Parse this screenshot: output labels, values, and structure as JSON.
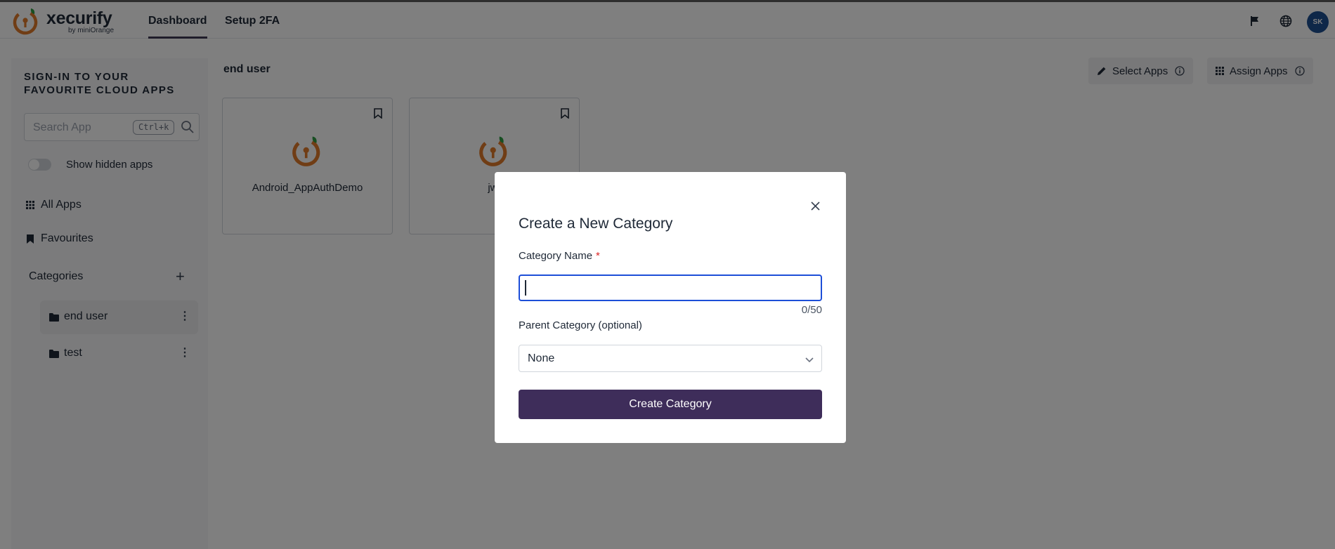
{
  "app": {
    "brand_name": "xecurify",
    "brand_by": "by miniOrange"
  },
  "header": {
    "tabs": [
      {
        "label": "Dashboard",
        "active": true
      },
      {
        "label": "Setup 2FA",
        "active": false
      }
    ],
    "icons": [
      "flag-icon",
      "globe-icon"
    ],
    "avatar_initials": "SK",
    "avatar_color": "#1d4f91"
  },
  "sidebar": {
    "heading": "SIGN-IN TO YOUR FAVOURITE CLOUD APPS",
    "search": {
      "placeholder": "Search App",
      "shortcut": "Ctrl+k"
    },
    "toggle_label": "Show hidden apps",
    "nav": [
      {
        "label": "All Apps",
        "icon": "grid-icon"
      },
      {
        "label": "Favourites",
        "icon": "bookmark-icon"
      }
    ],
    "categories_title": "Categories",
    "categories": [
      {
        "label": "end user",
        "active": true
      },
      {
        "label": "test",
        "active": false
      }
    ]
  },
  "main": {
    "title": "end user",
    "toolbar": {
      "select_apps": "Select Apps",
      "assign_apps": "Assign Apps"
    },
    "apps": [
      {
        "name": "Android_AppAuthDemo"
      },
      {
        "name": "jwt"
      }
    ]
  },
  "modal": {
    "title": "Create a New Category",
    "name_label": "Category Name",
    "name_required": "*",
    "name_value": "",
    "counter": "0/50",
    "parent_label": "Parent Category (optional)",
    "parent_value": "None",
    "submit_label": "Create Category",
    "submit_color": "#3e2d5a",
    "focus_color": "#1d4ed8"
  }
}
